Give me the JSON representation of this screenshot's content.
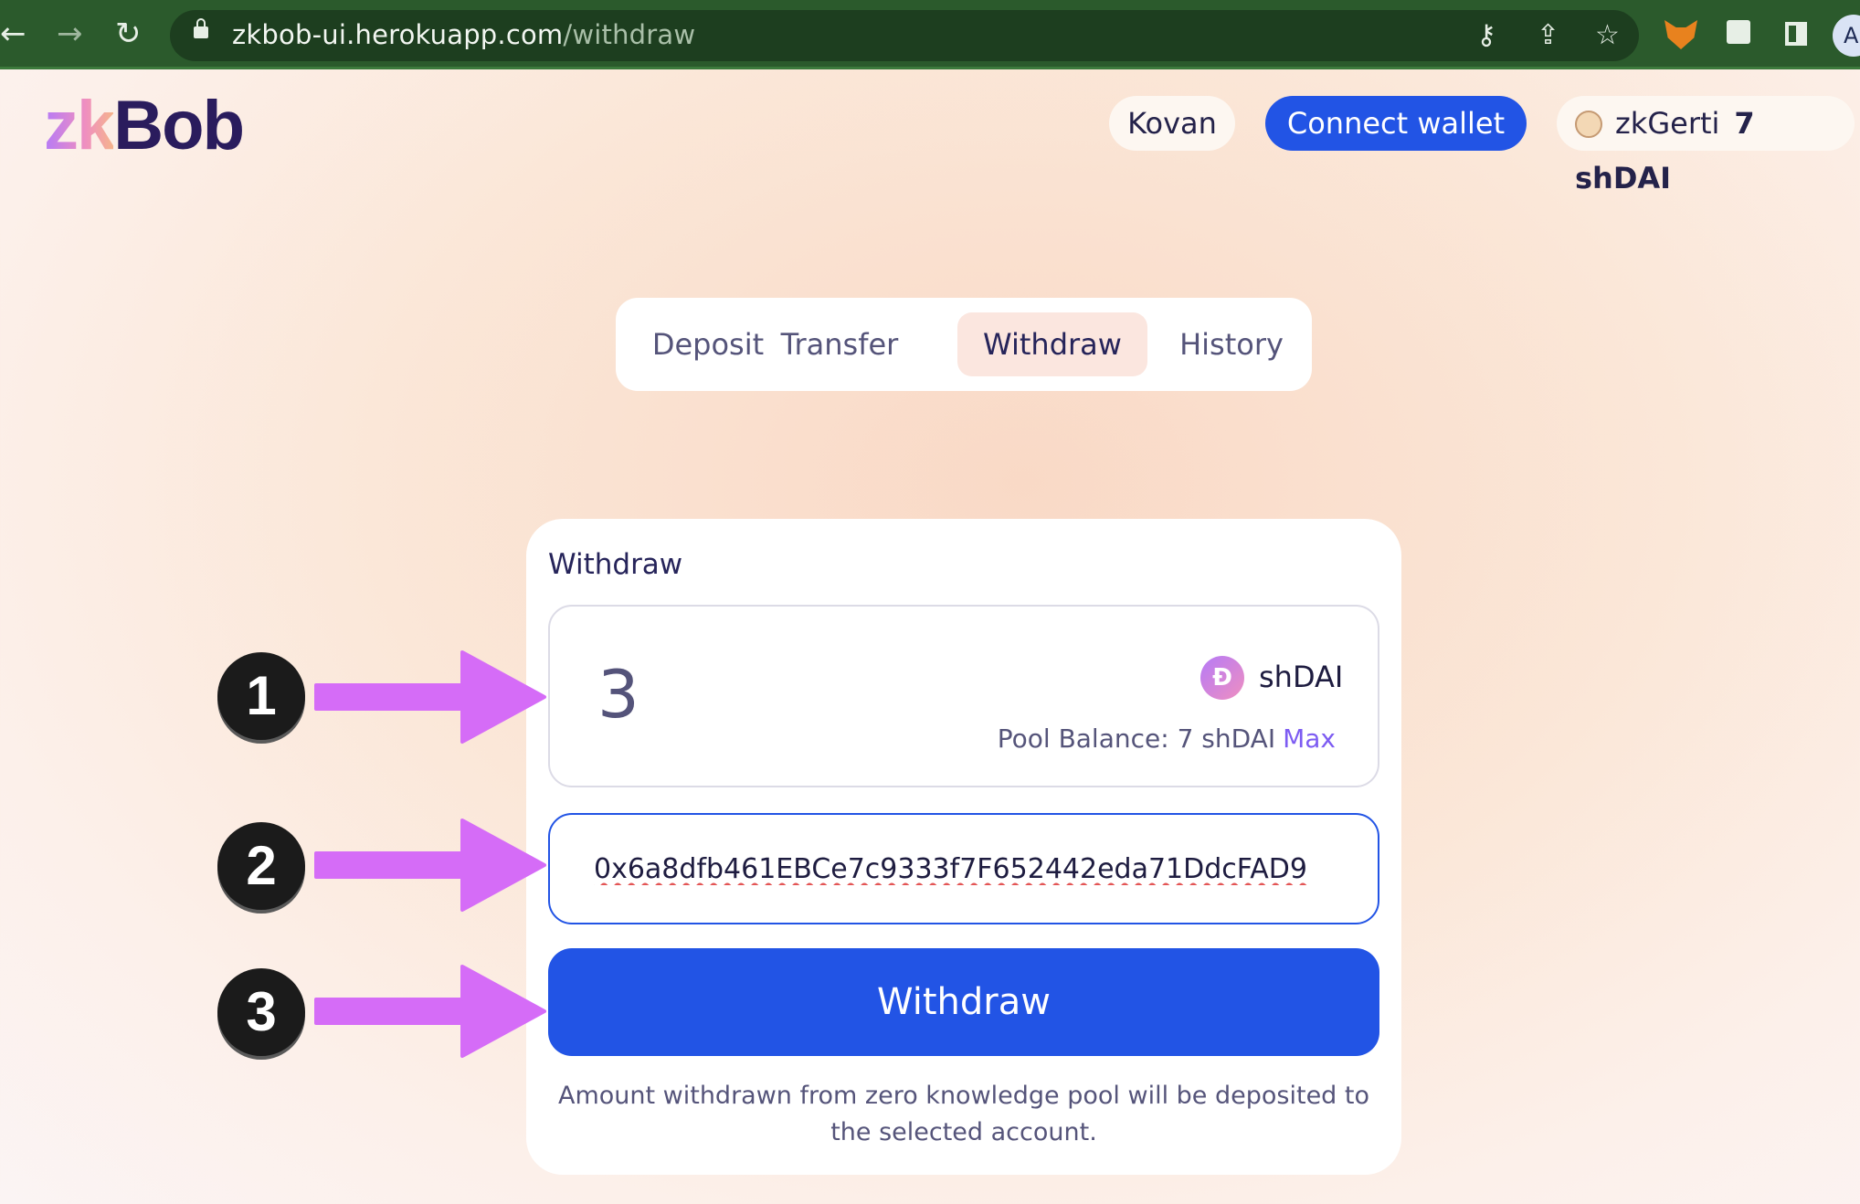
{
  "browser": {
    "url_host": "zkbob-ui.herokuapp.com",
    "url_path": "/withdraw",
    "back_icon": "back-arrow-icon",
    "forward_icon": "forward-arrow-icon",
    "reload_icon": "reload-icon",
    "profile_initial": "A"
  },
  "header": {
    "logo_zk": "zk",
    "logo_bob": "Bob",
    "network": "Kovan",
    "connect_wallet": "Connect wallet",
    "account_name": "zkGerti",
    "account_balance": "7 shDAI"
  },
  "tabs": [
    {
      "label": "Deposit",
      "active": false
    },
    {
      "label": "Transfer",
      "active": false
    },
    {
      "label": "Withdraw",
      "active": true
    },
    {
      "label": "History",
      "active": false
    }
  ],
  "withdraw_card": {
    "title": "Withdraw",
    "amount": "3",
    "token_symbol": "shDAI",
    "pool_balance_label": "Pool Balance: 7 shDAI",
    "max_label": "Max",
    "address": "0x6a8dfb461EBCe7c9333f7F652442eda71DdcFAD9",
    "button_label": "Withdraw",
    "footnote": "Amount withdrawn from zero knowledge pool will be deposited to the selected account."
  },
  "annotations": [
    "1",
    "2",
    "3"
  ],
  "colors": {
    "accent": "#2254e5",
    "active_tab_bg": "#fbe6df",
    "max_link": "#7d5cf2",
    "arrow": "#d56cf7",
    "marker_bg": "#1b1b1b"
  }
}
